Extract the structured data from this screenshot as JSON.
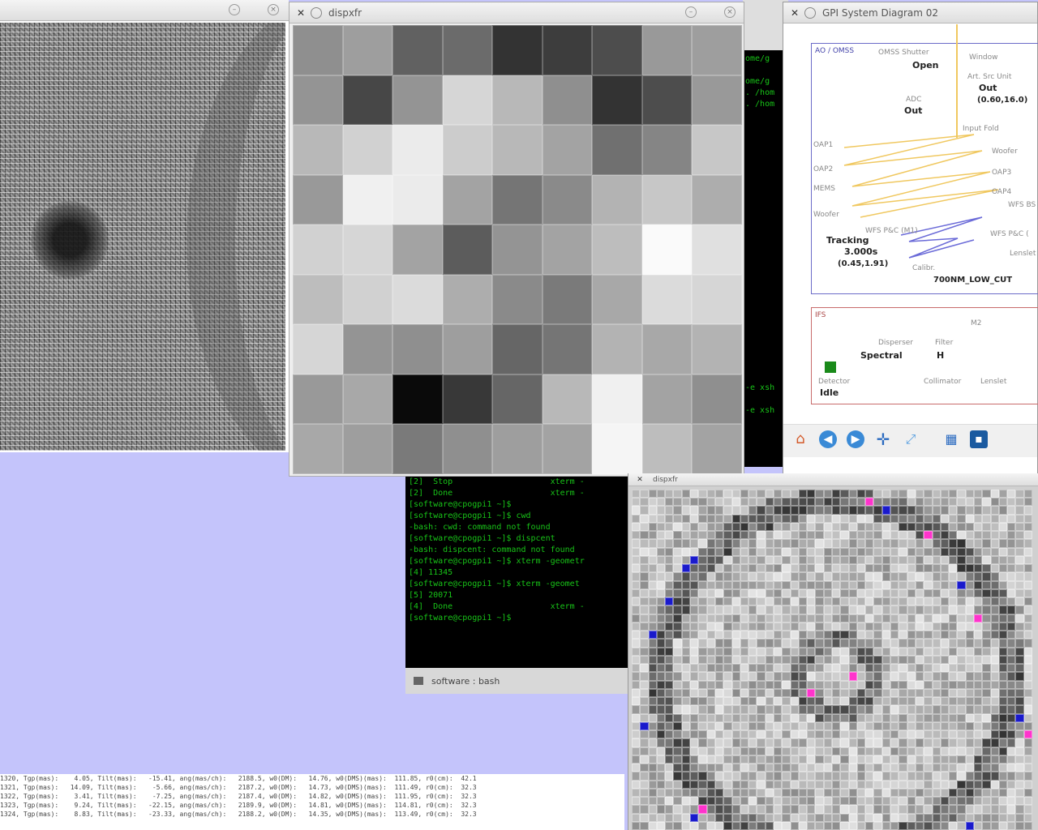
{
  "colors": {
    "desktop": "#c4c4fb",
    "terminal_text": "#18c418",
    "marker_magenta": "#ff33cc",
    "marker_blue": "#1a1acc"
  },
  "left_image": {
    "title": ""
  },
  "disp_window": {
    "title": "dispxfr"
  },
  "disp_grid": {
    "rows": 9,
    "cols": 9,
    "values": [
      [
        0.56,
        0.62,
        0.38,
        0.42,
        0.2,
        0.24,
        0.3,
        0.6,
        0.62
      ],
      [
        0.58,
        0.28,
        0.58,
        0.84,
        0.72,
        0.56,
        0.2,
        0.3,
        0.6
      ],
      [
        0.72,
        0.82,
        0.92,
        0.8,
        0.72,
        0.64,
        0.44,
        0.52,
        0.78
      ],
      [
        0.6,
        0.94,
        0.92,
        0.64,
        0.46,
        0.54,
        0.7,
        0.78,
        0.68
      ],
      [
        0.82,
        0.84,
        0.64,
        0.36,
        0.58,
        0.64,
        0.74,
        0.98,
        0.88
      ],
      [
        0.74,
        0.82,
        0.86,
        0.68,
        0.54,
        0.48,
        0.66,
        0.86,
        0.84
      ],
      [
        0.84,
        0.58,
        0.56,
        0.62,
        0.4,
        0.46,
        0.7,
        0.66,
        0.7
      ],
      [
        0.6,
        0.66,
        0.04,
        0.22,
        0.4,
        0.72,
        0.94,
        0.64,
        0.56
      ],
      [
        0.66,
        0.62,
        0.48,
        0.56,
        0.62,
        0.64,
        0.96,
        0.74,
        0.64
      ]
    ]
  },
  "background_terminal": {
    "lines": [
      "ome/g",
      "",
      "ome/g",
      ". /hom",
      ". /hom",
      "",
      "",
      "",
      "",
      "",
      "",
      "",
      "",
      "",
      "",
      "",
      "",
      "",
      "",
      "",
      "",
      "",
      "",
      "",
      "",
      "",
      "",
      "",
      "",
      "-e xsh",
      "",
      "-e xsh"
    ]
  },
  "terminal": {
    "lines": [
      "[2]  Stop                    xterm -",
      "[2]  Done                    xterm -",
      "[software@cpogpi1 ~]$",
      "[software@cpogpi1 ~]$ cwd",
      "-bash: cwd: command not found",
      "[software@cpogpi1 ~]$ dispcent",
      "-bash: dispcent: command not found",
      "[software@cpogpi1 ~]$ xterm -geometr",
      "[4] 11345",
      "[software@cpogpi1 ~]$ xterm -geomet",
      "[5] 20071",
      "[4]  Done                    xterm -",
      "[software@cpogpi1 ~]$ "
    ],
    "footer": "software : bash"
  },
  "gpi_window": {
    "title": "GPI System Diagram 02",
    "ao_box": {
      "header": "AO / OMSS",
      "shutter_label": "OMSS Shutter",
      "shutter_value": "Open",
      "window_label": "Window",
      "unit_label": "Art. Src Unit",
      "unit_value": "Out",
      "unit_coords": "(0.60,16.0)",
      "adc_label": "ADC",
      "adc_value": "Out",
      "input_label": "Input Fold",
      "lines_left": [
        "OAP1",
        "OAP2",
        "MEMS",
        "Woofer"
      ],
      "lines_right": [
        "Woofer",
        "OAP3",
        "OAP4",
        "WFS BS"
      ],
      "tracking_label": "Tracking",
      "tracking_value": "3.000s",
      "tracking_coords": "(0.45,1.91)",
      "wfs_label": "WFS P&C (M1)",
      "wfs_label2": "WFS P&C (",
      "lenslet_label": "Lenslet",
      "calib_label": "Calibr.",
      "filter_value": "700NM_LOW_CUT"
    },
    "ifs_box": {
      "header": "IFS",
      "disperser_label": "Disperser",
      "disperser_value": "Spectral",
      "filter_label": "Filter",
      "filter_value": "H",
      "detector_label": "Detector",
      "detector_value": "Idle",
      "collimator_label": "Collimator",
      "lenslet_label": "Lenslet",
      "m2_label": "M2"
    },
    "toolbar": [
      "home-icon",
      "back-icon",
      "forward-icon",
      "pan-icon",
      "zoom-icon",
      "config-icon",
      "save-icon"
    ]
  },
  "display_window": {
    "title": "dispxfr"
  },
  "status_lines": [
    "1320, Tgp(mas):    4.05, Tilt(mas):   -15.41, ang(mas/ch):   2188.5, w0(DM):   14.76, w0(DMS)(mas):  111.85, r0(cm):  42.1",
    "1321, Tgp(mas):   14.09, Tilt(mas):    -5.66, ang(mas/ch):   2187.2, w0(DM):   14.73, w0(DMS)(mas):  111.49, r0(cm):  32.3",
    "1322, Tgp(mas):    3.41, Tilt(mas):    -7.25, ang(mas/ch):   2187.4, w0(DM):   14.82, w0(DMS)(mas):  111.95, r0(cm):  32.3",
    "1323, Tgp(mas):    9.24, Tilt(mas):   -22.15, ang(mas/ch):   2189.9, w0(DM):   14.81, w0(DMS)(mas):  114.81, r0(cm):  32.3",
    "1324, Tgp(mas):    8.83, Tilt(mas):   -23.33, ang(mas/ch):   2188.2, w0(DM):   14.35, w0(DMS)(mas):  113.49, r0(cm):  32.3"
  ]
}
